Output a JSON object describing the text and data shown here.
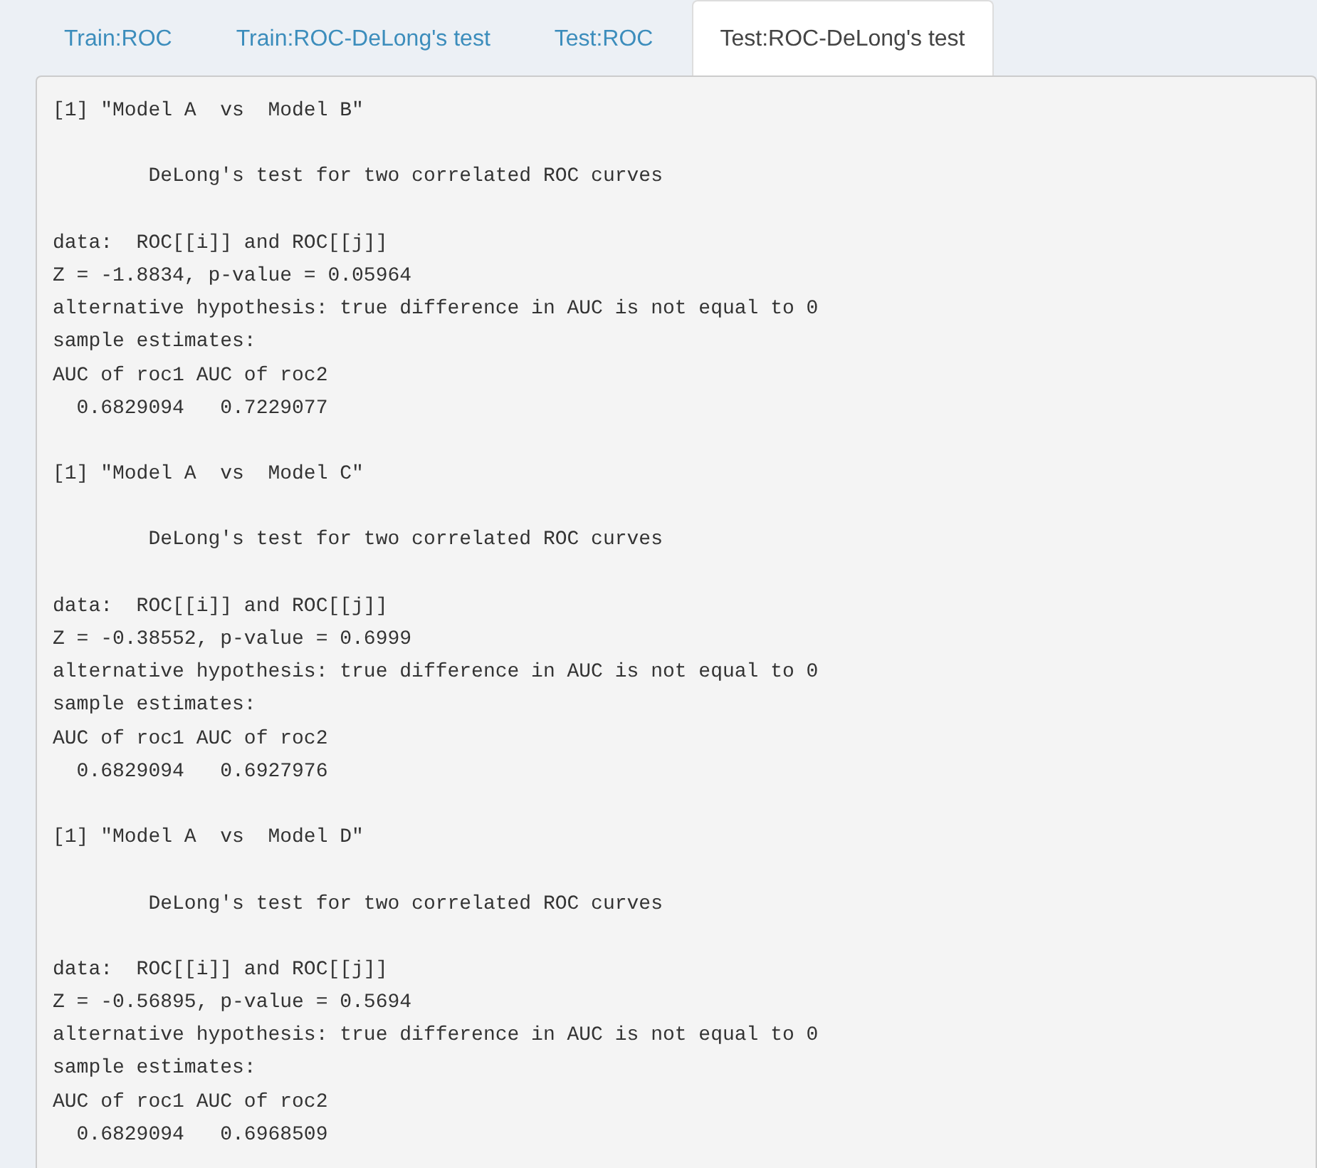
{
  "tabs": [
    {
      "label": "Train:ROC",
      "selected": false
    },
    {
      "label": "Train:ROC-DeLong's test",
      "selected": false
    },
    {
      "label": "Test:ROC",
      "selected": false
    },
    {
      "label": "Test:ROC-DeLong's test",
      "selected": true
    }
  ],
  "output": {
    "paragraphs": [
      [
        "[1] \"Model A  vs  Model B\""
      ],
      [
        "        DeLong's test for two correlated ROC curves"
      ],
      [
        "data:  ROC[[i]] and ROC[[j]]",
        "Z = -1.8834, p-value = 0.05964",
        "alternative hypothesis: true difference in AUC is not equal to 0",
        "sample estimates:",
        "AUC of roc1 AUC of roc2",
        "  0.6829094   0.7229077"
      ],
      [
        "[1] \"Model A  vs  Model C\""
      ],
      [
        "        DeLong's test for two correlated ROC curves"
      ],
      [
        "data:  ROC[[i]] and ROC[[j]]",
        "Z = -0.38552, p-value = 0.6999",
        "alternative hypothesis: true difference in AUC is not equal to 0",
        "sample estimates:",
        "AUC of roc1 AUC of roc2",
        "  0.6829094   0.6927976"
      ],
      [
        "[1] \"Model A  vs  Model D\""
      ],
      [
        "        DeLong's test for two correlated ROC curves"
      ],
      [
        "data:  ROC[[i]] and ROC[[j]]",
        "Z = -0.56895, p-value = 0.5694",
        "alternative hypothesis: true difference in AUC is not equal to 0",
        "sample estimates:",
        "AUC of roc1 AUC of roc2",
        "  0.6829094   0.6968509"
      ]
    ]
  }
}
